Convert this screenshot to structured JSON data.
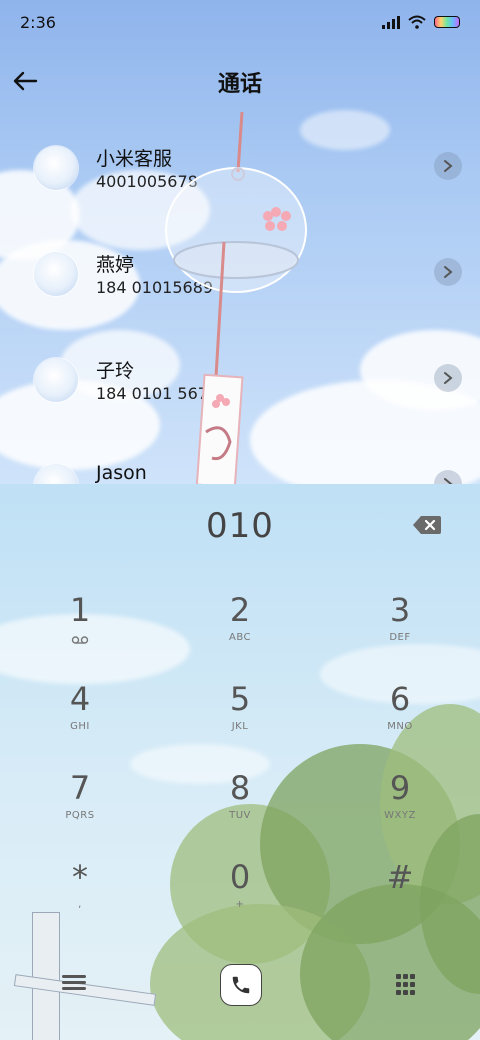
{
  "status_bar": {
    "time": "2:36"
  },
  "header": {
    "title": "通话"
  },
  "calls": [
    {
      "name": "小米客服",
      "number": "4001005678"
    },
    {
      "name": "燕婷",
      "number": "184 01015689"
    },
    {
      "name": "子玲",
      "number": "184 0101 5678"
    },
    {
      "name": "Jason",
      "number": ""
    }
  ],
  "dialer": {
    "input": "010",
    "keys": [
      {
        "digit": "1",
        "letters": ""
      },
      {
        "digit": "2",
        "letters": "ABC"
      },
      {
        "digit": "3",
        "letters": "DEF"
      },
      {
        "digit": "4",
        "letters": "GHI"
      },
      {
        "digit": "5",
        "letters": "JKL"
      },
      {
        "digit": "6",
        "letters": "MNO"
      },
      {
        "digit": "7",
        "letters": "PQRS"
      },
      {
        "digit": "8",
        "letters": "TUV"
      },
      {
        "digit": "9",
        "letters": "WXYZ"
      },
      {
        "digit": "*",
        "letters": ","
      },
      {
        "digit": "0",
        "letters": "+"
      },
      {
        "digit": "#",
        "letters": ""
      }
    ]
  },
  "icons": {
    "back": "back-arrow-icon",
    "chevron": "chevron-right-icon",
    "backspace": "backspace-icon",
    "voicemail": "voicemail-icon",
    "menu": "menu-icon",
    "call": "phone-icon",
    "keypad": "keypad-grid-icon"
  }
}
